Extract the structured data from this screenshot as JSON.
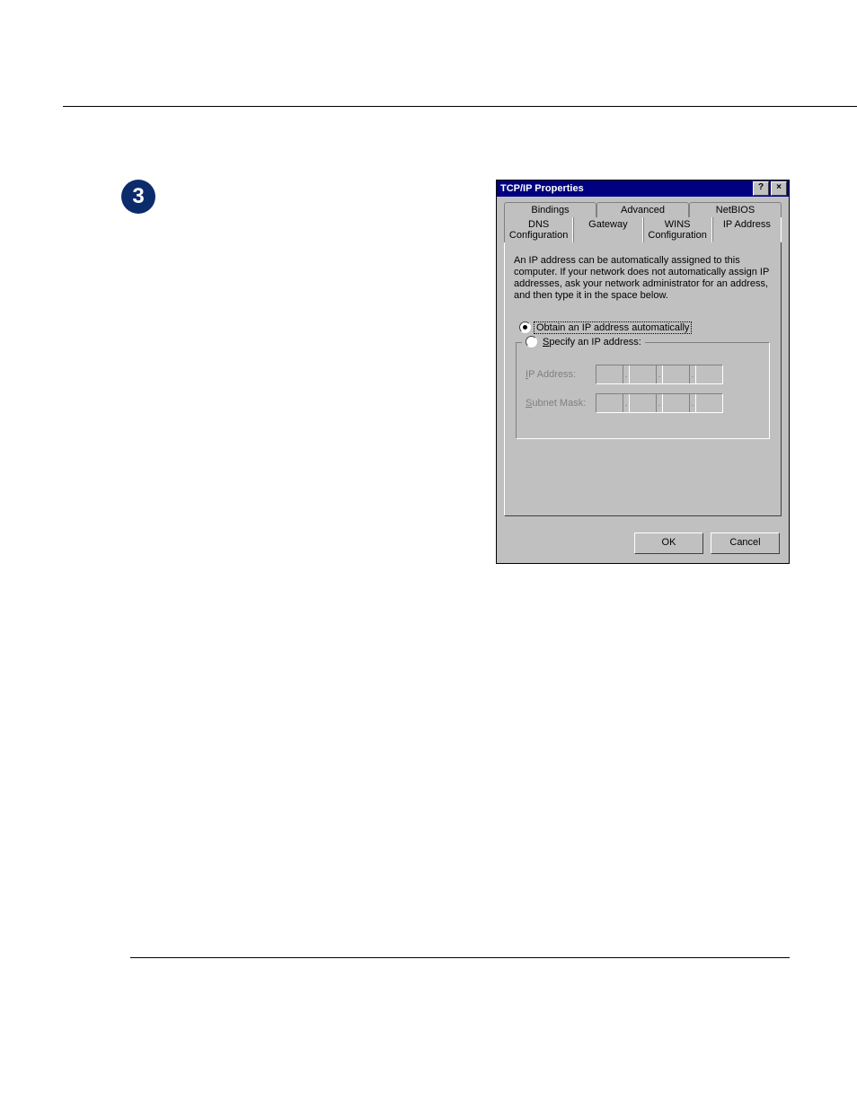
{
  "page": {
    "step_number": "3"
  },
  "dialog": {
    "title": "TCP/IP Properties",
    "help_btn": "?",
    "close_btn": "×",
    "tabs_row1": [
      "Bindings",
      "Advanced",
      "NetBIOS"
    ],
    "tabs_row2": [
      "DNS Configuration",
      "Gateway",
      "WINS Configuration",
      "IP Address"
    ],
    "active_tab": "IP Address",
    "description": "An IP address can be automatically assigned to this computer. If your network does not automatically assign IP addresses, ask your network administrator for an address, and then type it in the space below.",
    "radio_auto": "Obtain an IP address automatically",
    "radio_manual": "Specify an IP address:",
    "field_ip_label": "IP Address:",
    "field_mask_label": "Subnet Mask:",
    "ok_label": "OK",
    "cancel_label": "Cancel"
  }
}
